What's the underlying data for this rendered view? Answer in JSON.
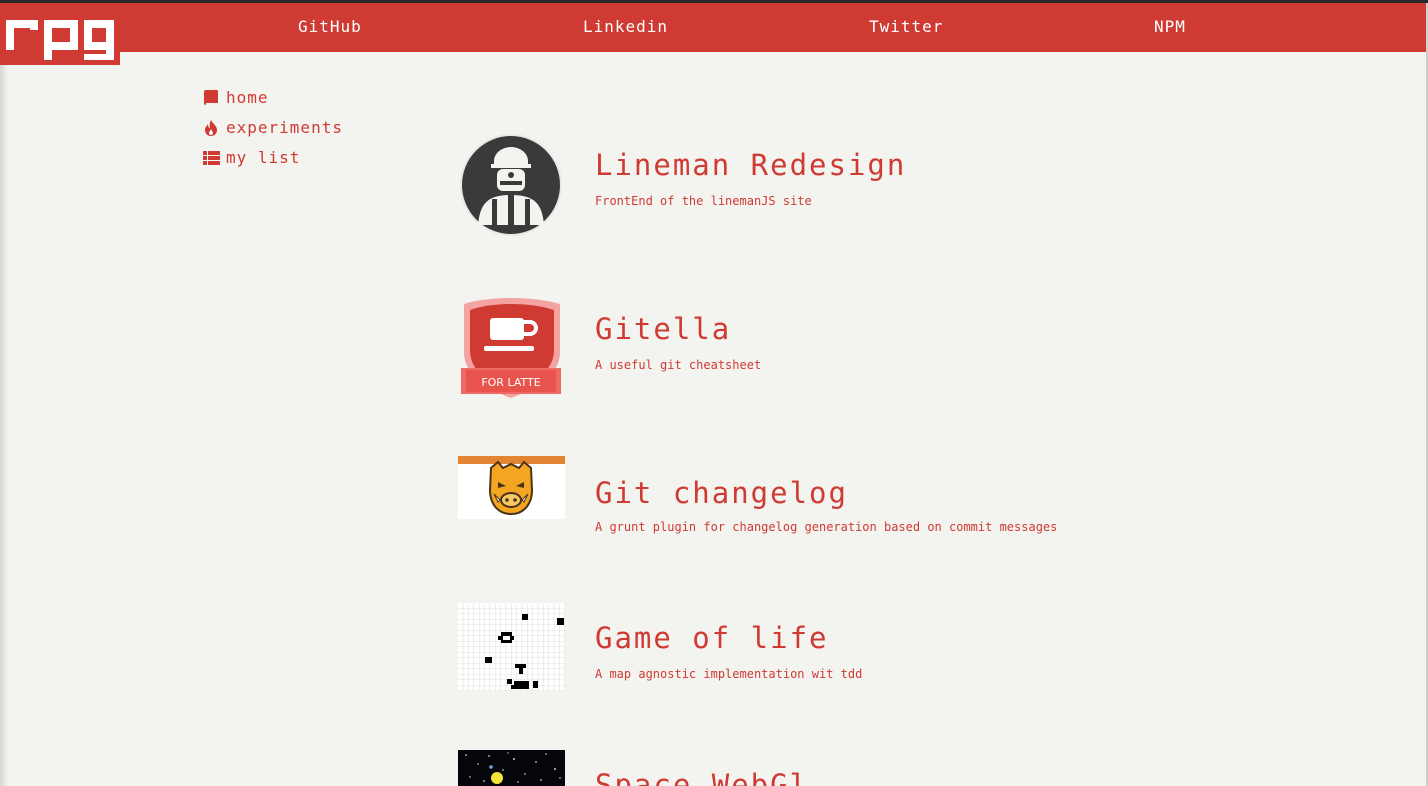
{
  "header": {
    "logo_text": "rpg",
    "nav": [
      "GitHub",
      "Linkedin",
      "Twitter",
      "NPM"
    ]
  },
  "sidebar": {
    "items": [
      {
        "label": "home",
        "icon": "book-icon"
      },
      {
        "label": "experiments",
        "icon": "fire-icon"
      },
      {
        "label": "my list",
        "icon": "list-icon"
      }
    ]
  },
  "projects": [
    {
      "title": "Lineman Redesign",
      "description": "FrontEnd of the linemanJS site",
      "thumb": "lineman-avatar"
    },
    {
      "title": "Gitella",
      "description": "A useful git cheatsheet",
      "thumb": "gitella-badge",
      "badge_text": "FOR LATTE"
    },
    {
      "title": "Git changelog",
      "description": "A grunt plugin for changelog generation based on commit messages",
      "thumb": "grunt-boar-logo"
    },
    {
      "title": "Game of life",
      "description": "A map agnostic implementation wit tdd",
      "thumb": "game-of-life-grid"
    },
    {
      "title": "Space WebGl",
      "thumb": "space-starfield"
    }
  ],
  "colors": {
    "accent": "#cf3b33",
    "background": "#f3f3f0"
  }
}
